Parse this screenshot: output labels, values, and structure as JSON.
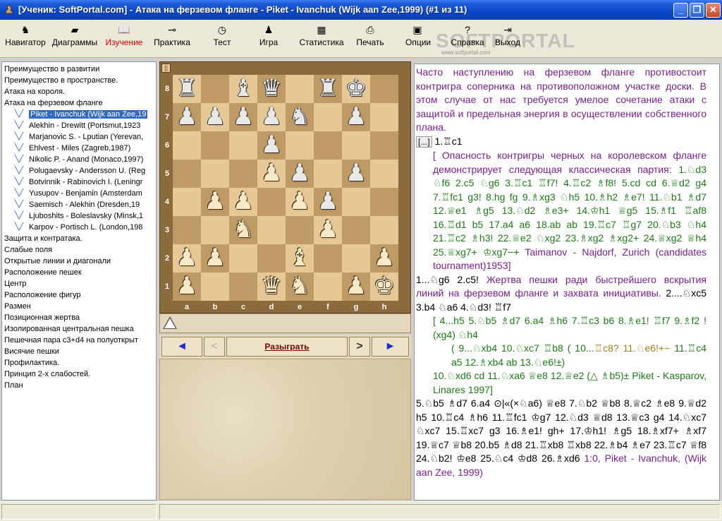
{
  "window": {
    "title": "[Ученик: SoftPortal.com]  - Атака на ферзевом фланге  - Piket - Ivanchuk (Wijk aan Zee,1999) (#1 из 11)",
    "minimize": "_",
    "maximize": "❐",
    "close": "✕"
  },
  "toolbar": {
    "items": [
      {
        "label": "Навигатор",
        "icon": "navigator-icon",
        "glyph": "♞"
      },
      {
        "label": "Диаграммы",
        "icon": "diagrams-icon",
        "glyph": "▰"
      },
      {
        "label": "Изучение",
        "icon": "book-icon",
        "glyph": "📖",
        "active": true
      },
      {
        "label": "Практика",
        "icon": "key-icon",
        "glyph": "⊸"
      },
      {
        "label": "Тест",
        "icon": "clock-icon",
        "glyph": "◷"
      },
      {
        "label": "Игра",
        "icon": "pawn-icon",
        "glyph": "♟"
      },
      {
        "label": "Статистика",
        "icon": "table-icon",
        "glyph": "▦"
      },
      {
        "label": "Печать",
        "icon": "printer-icon",
        "glyph": "⎙"
      },
      {
        "label": "Опции",
        "icon": "monitor-icon",
        "glyph": "▣"
      },
      {
        "label": "Справка",
        "icon": "help-icon",
        "glyph": "?"
      },
      {
        "label": "Выход",
        "icon": "exit-icon",
        "glyph": "⇥"
      }
    ],
    "watermark": "SOFTPORTAL",
    "watermark_url": "www.softportal.com"
  },
  "tree": {
    "items": [
      {
        "label": "Преимущество в развитии",
        "level": 0
      },
      {
        "label": "Преимущество в пространстве.",
        "level": 0
      },
      {
        "label": "Атака на короля.",
        "level": 0
      },
      {
        "label": "Атака на ферзевом фланге",
        "level": 0
      },
      {
        "label": "Piket - Ivanchuk (Wijk aan Zee,19",
        "level": 1,
        "selected": true
      },
      {
        "label": "Alekhin - Drewitt (Portsmut,1923",
        "level": 1
      },
      {
        "label": "Marjanovic S. - Lputian (Yerevan,",
        "level": 1
      },
      {
        "label": "Ehlvest - Miles (Zagreb,1987)",
        "level": 1
      },
      {
        "label": "Nikolic P. - Anand (Monaco,1997)",
        "level": 1
      },
      {
        "label": "Polugaevsky - Andersson U. (Reg",
        "level": 1
      },
      {
        "label": "Botvinnik - Rabinovich I. (Leningr",
        "level": 1
      },
      {
        "label": "Yusupov - Benjamin (Amsterdam",
        "level": 1
      },
      {
        "label": "Saemisch - Alekhin (Dresden,19",
        "level": 1
      },
      {
        "label": "Ljuboshits - Boleslavsky (Minsk,1",
        "level": 1
      },
      {
        "label": "Karpov - Portisch L. (London,198",
        "level": 1
      },
      {
        "label": "Защита и контратака.",
        "level": 0
      },
      {
        "label": "Слабые поля",
        "level": 0
      },
      {
        "label": "Открытые линии и диагонали",
        "level": 0
      },
      {
        "label": "Расположение пешек",
        "level": 0
      },
      {
        "label": "Центр",
        "level": 0
      },
      {
        "label": "Расположение фигур",
        "level": 0
      },
      {
        "label": "Размен",
        "level": 0
      },
      {
        "label": "Позиционная жертва",
        "level": 0
      },
      {
        "label": "Изолированная центральная пешка",
        "level": 0
      },
      {
        "label": "Пешечная пара c3+d4 на полуоткрыт",
        "level": 0
      },
      {
        "label": "Висячие пешки",
        "level": 0
      },
      {
        "label": "Профилактика.",
        "level": 0
      },
      {
        "label": "Принцип 2-х слабостей.",
        "level": 0
      },
      {
        "label": "План",
        "level": 0
      }
    ]
  },
  "board": {
    "ranks": [
      "8",
      "7",
      "6",
      "5",
      "4",
      "3",
      "2",
      "1"
    ],
    "files": [
      "a",
      "b",
      "c",
      "d",
      "e",
      "f",
      "g",
      "h"
    ],
    "position": [
      "r.bq.rk.",
      "ppppn.p.",
      "...p....",
      "...Pp.p.",
      ".PP.Pp..",
      "..N..P..",
      "PP..B..P",
      "P..QN.PK"
    ]
  },
  "side_to_move": "white",
  "nav": {
    "first": "◄",
    "prev": "<",
    "play": "Разыграть",
    "next": ">",
    "last": "►"
  },
  "notes": {
    "intro": "Часто наступлению на ферзевом фланге противостоит контригра соперника на противоположном участке доски. В этом случае от нас требуется умелое сочетание атаки с защитой и предельная энергия в осуществлении собственного плана.",
    "collapse_button": "[...]",
    "move1": "1.♖c1",
    "comment1": "[ Опасность контригры черных на королевском фланге демонстрирует следующая классическая партия:",
    "variation1": "1.♘d3 ♘f6 2.c5 ♘g6 3.♖c1 ♖f7! 4.♖c2 ♗f8! 5.cd cd 6.♕d2 g4 7.♖fc1 g3! 8.hg fg 9.♗xg3 ♘h5 10.♗h2 ♗e7! 11.♘b1 ♗d7 12.♕e1 ♗g5 13.♘d2 ♗e3+ 14.♔h1 ♕g5 15.♗f1 ♖af8 16.♖d1 b5 17.a4 a6 18.ab ab 19.♖c7 ♖g7 20.♘b3 ♘h4 21.♖c2 ♗h3! 22.♕e2 ♘xg2 23.♗xg2 ♗xg2+ 24.♕xg2 ♕h4 25.♕xg7+ ♔xg7−+",
    "source1": "Taimanov - Najdorf, Zurich (candidates tournament)1953]",
    "main2": "1...♘g6 2.c5!",
    "comment2": "Жертва пешки ради быстрейшего вскрытия линий на ферзевом фланге и захвата инициативы.",
    "main2b": "2....♘xc5 3.b4 ♘a6 4.♘d3! ♖f7",
    "variation2": "[ 4...h5 5.♘b5 ♗d7 6.a4 ♗h6 7.♖c3 b6 8.♗e1! ♖f7 9.♗f2 !(xg4) ♘h4",
    "variation3a": "( 9...♘xb4 10.♘xc7 ♖b8 ( 10...",
    "variation3b": "♖c8? 11.♘e6!+−",
    "variation3c": " 11.♖c4 a5 12.♗xb4 ab 13.♘e6!±)",
    "variation4": "10.♘xd6 cd 11.♘xa6 ♕e8 12.♕e2 (△ ♗b5)± Piket - Kasparov, Linares 1997]",
    "main3": "5.♘b5 ♗d7 6.a4 ⊙|«(×♘a6) ♕e8 7.♘b2 ♕b8 8.♕c2 ♗e8 9.♕d2 h5 10.♖c4 ♗h6 11.♖fc1 ♔g7 12.♘d3 ♕d8 13.♕c3 g4 14.♘xc7 ♘xc7 15.♖xc7 g3 16.♗e1! gh+ 17.♔h1! ♗g5 18.♗xf7+ ♗xf7 19.♕c7 ♕b8 20.b5 ♗d8 21.♖xb8 ♖xb8 22.♗b4 ♗e7 23.♖c7 ♕f8 24.♘b2! ♔e8 25.♘c4 ♔d8 26.♗xd6",
    "result": "1:0, Piket - Ivanchuk, (Wijk aan Zee, 1999)"
  },
  "colors": {
    "title_bar": "#0a47c8",
    "light_square": "#e6c896",
    "dark_square": "#c09a64",
    "board_frame": "#8b6a3c",
    "notes_purple": "#7a1f8f",
    "notes_green": "#1a7d14",
    "active_tool": "#e00000"
  }
}
